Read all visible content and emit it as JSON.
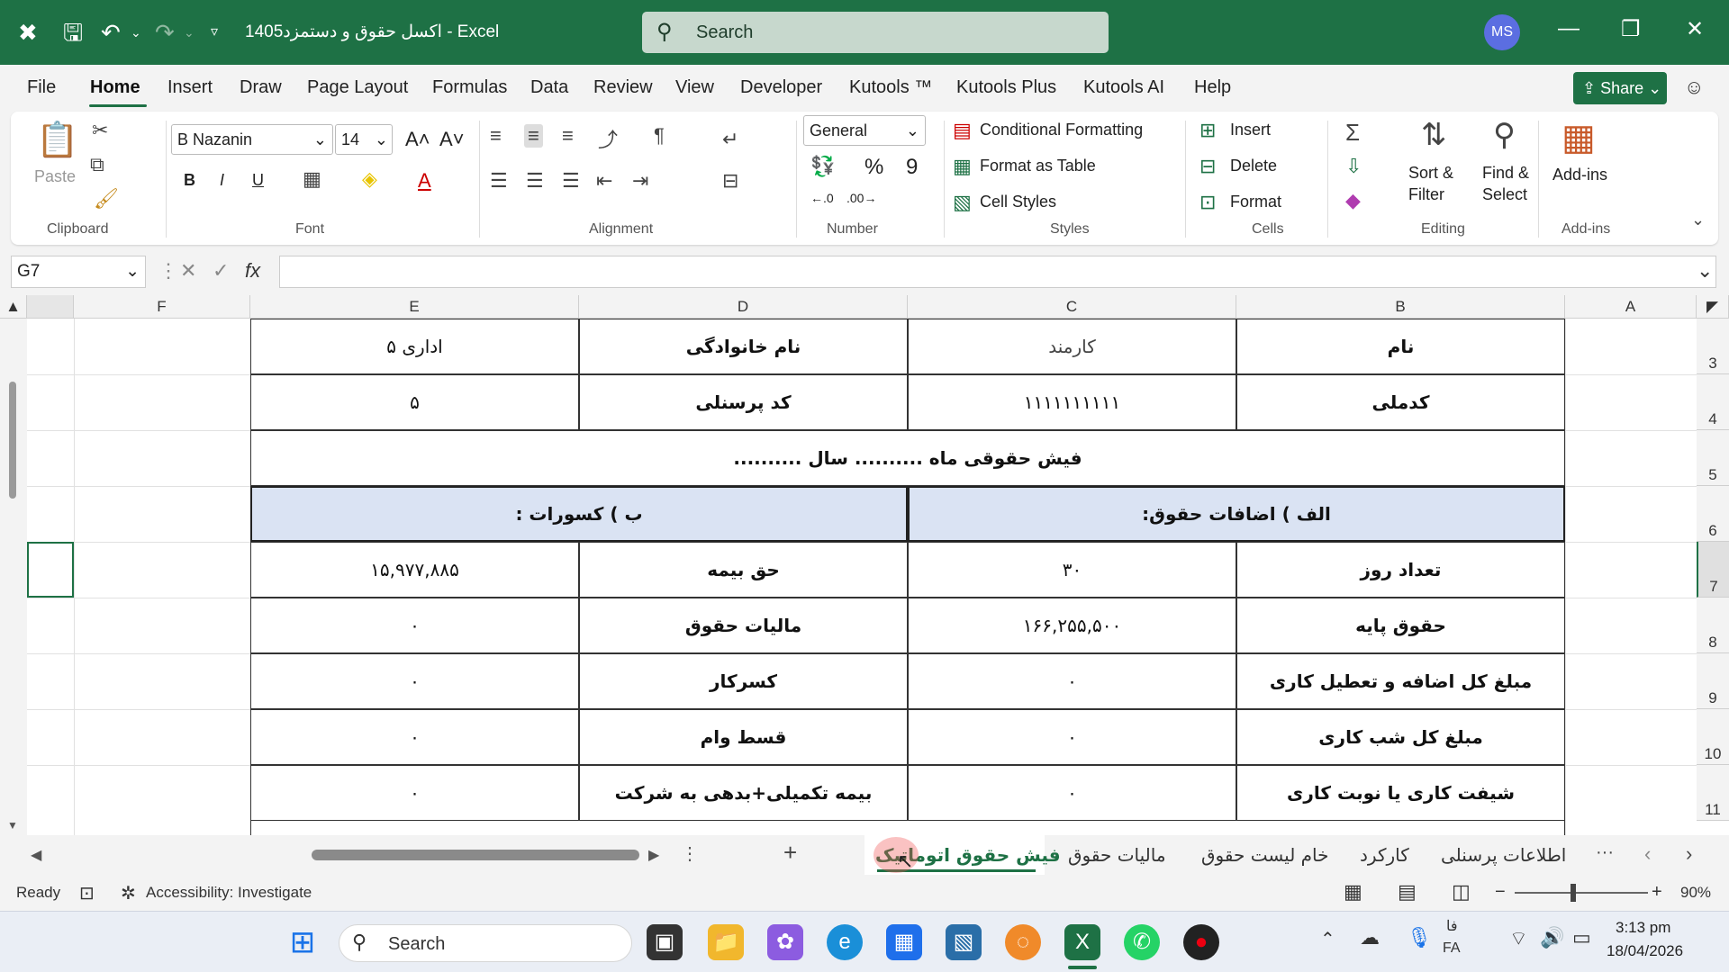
{
  "titlebar": {
    "title": "اکسل حقوق و دستمزد1405  -  Excel",
    "search_placeholder": "Search",
    "avatar_initials": "MS",
    "accent_color": "#1e7145"
  },
  "menu": {
    "items": [
      "File",
      "Home",
      "Insert",
      "Draw",
      "Page Layout",
      "Formulas",
      "Data",
      "Review",
      "View",
      "Developer",
      "Kutools ™",
      "Kutools Plus",
      "Kutools AI",
      "Help"
    ],
    "active": "Home",
    "share_label": "Share"
  },
  "ribbon": {
    "clipboard": {
      "paste_label": "Paste",
      "group_label": "Clipboard"
    },
    "font": {
      "font_name": "B Nazanin",
      "font_size": "14",
      "group_label": "Font",
      "bold": "B",
      "italic": "I",
      "underline": "U"
    },
    "alignment": {
      "group_label": "Alignment"
    },
    "number": {
      "format": "General",
      "group_label": "Number"
    },
    "styles": {
      "conditional": "Conditional Formatting",
      "format_table": "Format as Table",
      "cell_styles": "Cell Styles",
      "group_label": "Styles"
    },
    "cells": {
      "insert": "Insert",
      "delete": "Delete",
      "format": "Format",
      "group_label": "Cells"
    },
    "editing": {
      "sort_filter_1": "Sort &",
      "sort_filter_2": "Filter",
      "find_select_1": "Find &",
      "find_select_2": "Select",
      "group_label": "Editing"
    },
    "addins": {
      "label": "Add-ins",
      "group_label": "Add-ins"
    }
  },
  "formula_bar": {
    "name_box": "G7",
    "fx": "fx",
    "value": ""
  },
  "columns": [
    "A",
    "B",
    "C",
    "D",
    "E",
    "F"
  ],
  "rows": [
    "3",
    "4",
    "5",
    "6",
    "7",
    "8",
    "9",
    "10",
    "11"
  ],
  "sheet": {
    "r3": {
      "b": "نام",
      "c": "کارمند",
      "d": "نام خانوادگی",
      "e": "اداری ۵"
    },
    "r4": {
      "b": "کدملی",
      "c": "۱۱۱۱۱۱۱۱۱۱",
      "d": "کد پرسنلی",
      "e": "۵"
    },
    "r5": "فیش حقوقی ماه .......... سال ..........",
    "r6": {
      "left": "الف ) اضافات حقوق:",
      "right": "ب ) کسورات :"
    },
    "r7": {
      "b": "تعداد روز",
      "c": "۳۰",
      "d": "حق بیمه",
      "e": "۱۵,۹۷۷,۸۸۵"
    },
    "r8": {
      "b": "حقوق پایه",
      "c": "۱۶۶,۲۵۵,۵۰۰",
      "d": "مالیات حقوق",
      "e": "۰"
    },
    "r9": {
      "b": "مبلغ کل اضافه و تعطیل کاری",
      "c": "۰",
      "d": "کسرکار",
      "e": "۰"
    },
    "r10": {
      "b": "مبلغ کل شب کاری",
      "c": "۰",
      "d": "قسط وام",
      "e": "۰"
    },
    "r11": {
      "b": "شیفت کاری یا نوبت کاری",
      "c": "۰",
      "d": "بیمه تکمیلی+بدهی به شرکت",
      "e": "۰"
    }
  },
  "tabs": {
    "items": [
      "فیش حقوق اتوماتیک",
      "مالیات حقوق",
      "خام لیست حقوق",
      "کارکرد",
      "اطلاعات پرسنلی"
    ],
    "active": "فیش حقوق اتوماتیک",
    "more": "···"
  },
  "status": {
    "ready": "Ready",
    "accessibility": "Accessibility: Investigate",
    "zoom": "90%"
  },
  "taskbar": {
    "search": "Search",
    "lang_top": "فا",
    "lang_bottom": "FA",
    "time": "3:13 pm",
    "date": "18/04/2026"
  }
}
